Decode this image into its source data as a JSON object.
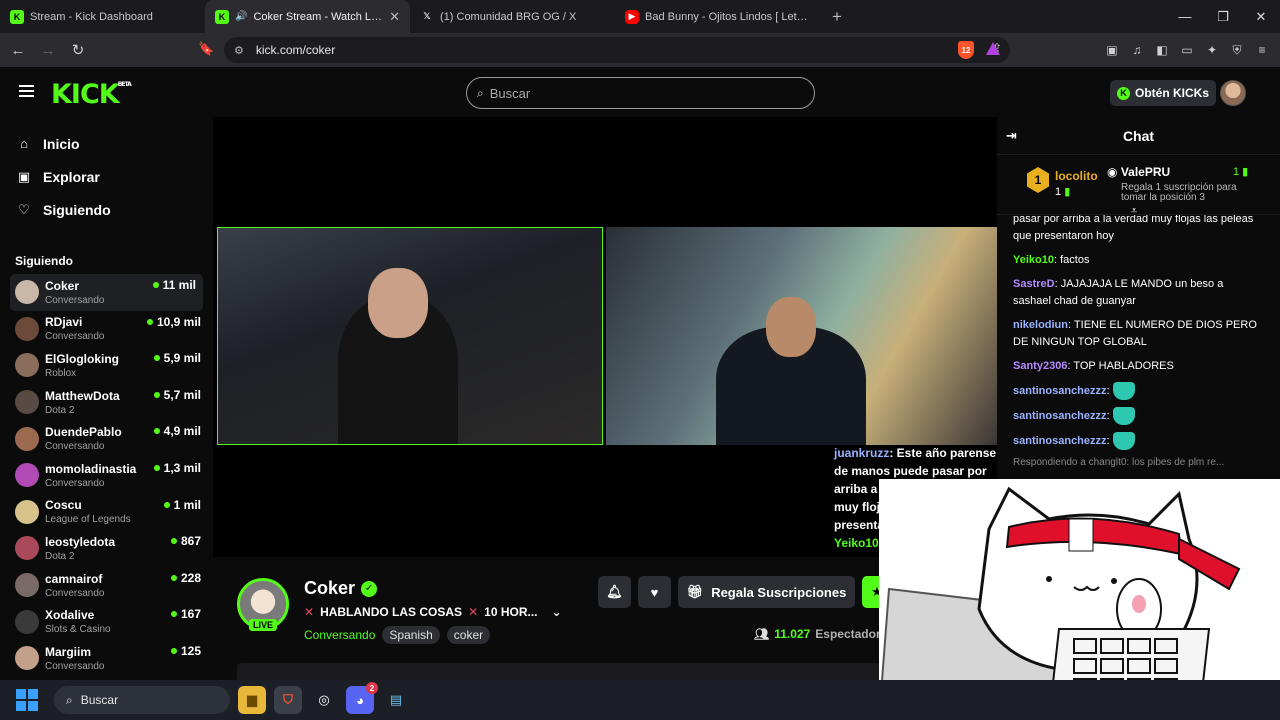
{
  "browser": {
    "tabs": [
      {
        "label": "Stream - Kick Dashboard",
        "icon": "kick-icon",
        "active": false
      },
      {
        "label": "Coker Stream - Watch Live on",
        "icon": "kick-icon",
        "active": true
      },
      {
        "label": "(1) Comunidad BRG OG / X",
        "icon": "x-icon",
        "active": false
      },
      {
        "label": "Bad Bunny - Ojitos Lindos [ Letra/Lyr",
        "icon": "youtube-icon",
        "active": false
      }
    ],
    "url": "kick.com/coker",
    "brave_badge": "12"
  },
  "header": {
    "logo": "KICK",
    "logo_beta": "BETA",
    "search_placeholder": "Buscar",
    "kicks_button": "Obtén KICKs"
  },
  "sidebar": {
    "nav": [
      {
        "label": "Inicio",
        "icon": "home-icon"
      },
      {
        "label": "Explorar",
        "icon": "explore-icon"
      },
      {
        "label": "Siguiendo",
        "icon": "heart-icon"
      }
    ],
    "section_label": "Siguiendo",
    "following": [
      {
        "name": "Coker",
        "category": "Conversando",
        "viewers": "11 mil",
        "color": "#c9b8a8"
      },
      {
        "name": "RDjavi",
        "category": "Conversando",
        "viewers": "10,9 mil",
        "color": "#6b4a3a"
      },
      {
        "name": "ElGlogloking",
        "category": "Roblox",
        "viewers": "5,9 mil",
        "color": "#8a6d5a"
      },
      {
        "name": "MatthewDota",
        "category": "Dota 2",
        "viewers": "5,7 mil",
        "color": "#5a4a44"
      },
      {
        "name": "DuendePablo",
        "category": "Conversando",
        "viewers": "4,9 mil",
        "color": "#9b6a4e"
      },
      {
        "name": "momoladinastia",
        "category": "Conversando",
        "viewers": "1,3 mil",
        "color": "#b24ab5"
      },
      {
        "name": "Coscu",
        "category": "League of Legends",
        "viewers": "1 mil",
        "color": "#d7c28a"
      },
      {
        "name": "leostyledota",
        "category": "Dota 2",
        "viewers": "867",
        "color": "#a84a5a"
      },
      {
        "name": "camnairof",
        "category": "Conversando",
        "viewers": "228",
        "color": "#7a6a66"
      },
      {
        "name": "Xodalive",
        "category": "Slots & Casino",
        "viewers": "167",
        "color": "#3a3a3a"
      },
      {
        "name": "Margiim",
        "category": "Conversando",
        "viewers": "125",
        "color": "#c2a08a"
      }
    ]
  },
  "stream": {
    "streamer": "Coker",
    "live_badge": "LIVE",
    "title": "HABLANDO LAS COSAS",
    "title_suffix": "10 HOR...",
    "category": "Conversando",
    "tags": [
      "Spanish",
      "coker"
    ],
    "viewers": "11.027",
    "viewers_label": "Espectador",
    "gift_button": "Regala Suscripciones",
    "overlay_chat": {
      "user1": "juankruzz",
      "text1": ": Este año parense de manos puede pasar por arriba a",
      "text1b": "muy floj",
      "text1c": "presenta",
      "user2": "Yeiko10"
    }
  },
  "chat": {
    "title": "Chat",
    "pinned": {
      "top_gifter": "locolito",
      "top_gifter_count": "1",
      "rank_badge": "1",
      "second_user": "ValePRU",
      "second_count": "1",
      "second_cta": "Regala 1 suscripción para tomar la posición 3"
    },
    "messages": [
      {
        "user": "",
        "text": "pasar por arriba a la verdad muy flojas las peleas que presentaron hoy",
        "color": "#ffffff"
      },
      {
        "user": "Yeiko10",
        "text": ": factos",
        "color": "#53fc18"
      },
      {
        "user": "SastreD",
        "text": ": JAJAJAJA LE MANDO un beso a sashael chad de guanyar",
        "color": "#b48aff"
      },
      {
        "user": "nikelodiun",
        "text": ": TIENE EL NUMERO DE DIOS PERO DE NINGUN TOP GLOBAL",
        "color": "#9bb2ff"
      },
      {
        "user": "Santy2306",
        "text": ": TOP HABLADORES",
        "color": "#b48aff"
      },
      {
        "user": "santinosanchezzz",
        "text": ":",
        "color": "#9bb2ff",
        "emote": true
      },
      {
        "user": "santinosanchezzz",
        "text": ":",
        "color": "#9bb2ff",
        "emote": true
      },
      {
        "user": "santinosanchezzz",
        "text": ":",
        "color": "#9bb2ff",
        "emote": true
      }
    ],
    "reply_hint": "Respondiendo a changlt0: los pibes de plm re..."
  },
  "taskbar": {
    "search_label": "Buscar",
    "discord_badge": "2"
  }
}
